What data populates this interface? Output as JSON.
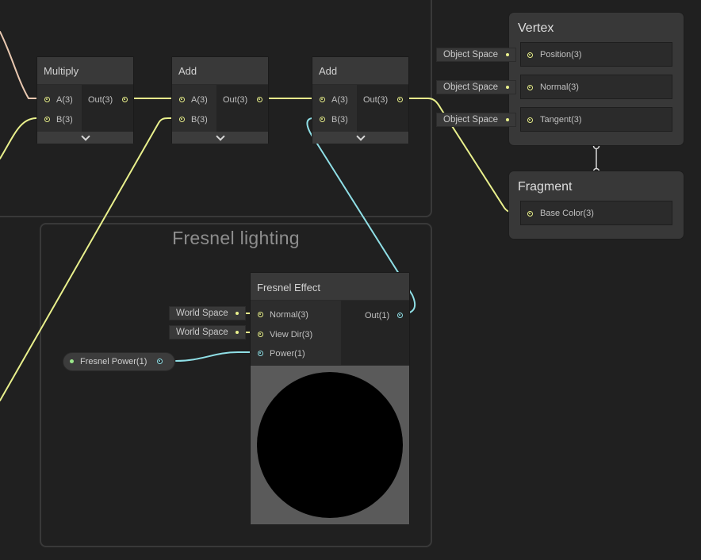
{
  "groups": {
    "fresnel_title": "Fresnel lighting"
  },
  "nodes": {
    "multiply": {
      "title": "Multiply",
      "in_a": "A(3)",
      "in_b": "B(3)",
      "out": "Out(3)"
    },
    "add1": {
      "title": "Add",
      "in_a": "A(3)",
      "in_b": "B(3)",
      "out": "Out(3)"
    },
    "add2": {
      "title": "Add",
      "in_a": "A(3)",
      "in_b": "B(3)",
      "out": "Out(3)"
    },
    "fresnel": {
      "title": "Fresnel Effect",
      "in_normal": "Normal(3)",
      "in_viewdir": "View Dir(3)",
      "in_power": "Power(1)",
      "out": "Out(1)",
      "tag_normal": "World Space",
      "tag_viewdir": "World Space"
    }
  },
  "property": {
    "fresnel_power": "Fresnel Power(1)"
  },
  "vertex": {
    "title": "Vertex",
    "position": "Position(3)",
    "normal": "Normal(3)",
    "tangent": "Tangent(3)",
    "tag_position": "Object Space",
    "tag_normal": "Object Space",
    "tag_tangent": "Object Space"
  },
  "fragment": {
    "title": "Fragment",
    "base_color": "Base Color(3)"
  },
  "colors": {
    "vector3_wire": "#e9f08c",
    "float_wire": "#8fdfe6",
    "background": "#202020"
  },
  "icons": {
    "collapse": "chevron-down-icon",
    "port": "port-dot-icon"
  }
}
